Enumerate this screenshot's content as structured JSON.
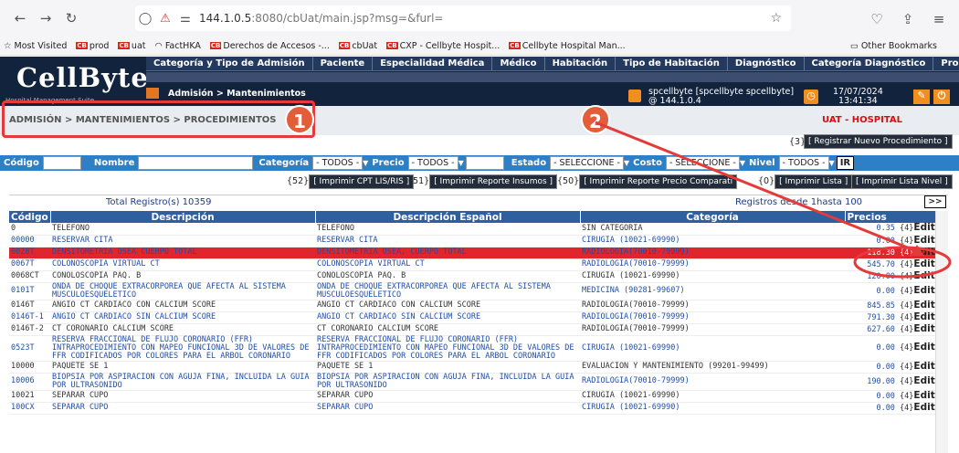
{
  "browser": {
    "url": "144.1.0.5:8080/cbUat/main.jsp?msg=&furl=",
    "url_host": "144.1.0.5",
    "url_rest": ":8080/cbUat/main.jsp?msg=&furl=",
    "bookmarks": [
      "Most Visited",
      "prod",
      "uat",
      "FactHKA",
      "Derechos de Accesos -...",
      "cbUat",
      "CXP - Cellbyte Hospit...",
      "Cellbyte Hospital Man..."
    ],
    "other_bookmarks": "Other Bookmarks",
    "cb_label": "CB"
  },
  "app": {
    "logo": "CellByte",
    "logo_sub": "Hospital Management Suite",
    "menu": [
      "Categoría y Tipo de Admisión",
      "Paciente",
      "Especialidad Médica",
      "Médico",
      "Habitación",
      "Tipo de Habitación",
      "Diagnóstico",
      "Categoría Diagnóstico",
      "Procedi"
    ],
    "nav_crumb": "Admisión > Mantenimientos",
    "user_line1": "spcellbyte [spcellbyte spcellbyte]",
    "user_line2": "@ 144.1.0.4",
    "date": "17/07/2024",
    "time": "13:41:34"
  },
  "page": {
    "breadcrumb": "ADMISIÓN > MANTENIMIENTOS > PROCEDIMIENTOS",
    "hospital": "UAT - HOSPITAL",
    "reg_count": "{3}",
    "reg_button": "[ Registrar Nuevo Procedimiento ]"
  },
  "filters": {
    "codigo": "Código",
    "nombre": "Nombre",
    "categoria": "Categoría",
    "categoria_val": "- TODOS -",
    "precio": "Precio",
    "precio_val": "- TODOS -",
    "estado": "Estado",
    "estado_val": "- SELECCIONE -",
    "costo": "Costo",
    "costo_val": "- SELECCIONE -",
    "nivel": "Nivel",
    "nivel_val": "- TODOS -",
    "ir": "IR"
  },
  "actions": {
    "c1": "{52}",
    "b1": "[ Imprimir CPT LIS/RIS ]",
    "c2": "{51}",
    "b2": "[ Imprimir Reporte Insumos ]",
    "c3": "{50}",
    "b3": "[ Imprimir Reporte Precio Comparati",
    "c4": "{0}",
    "b4": "[ Imprimir Lista ]",
    "b5": "[ Imprimir Lista Nivel ]"
  },
  "pager": {
    "total": "Total Registro(s) 10359",
    "range": "Registros desde 1hasta 100",
    "next": ">>"
  },
  "table": {
    "headers": [
      "Código",
      "Descripción",
      "Descripción Español",
      "Categoría",
      "Precios"
    ],
    "edit_label": "Editar",
    "edit_count": "{4}",
    "rows": [
      {
        "code": "0",
        "desc": "TELEFONO",
        "desc_es": "TELEFONO",
        "cat": "SIN CATEGORIA",
        "price": "0.35",
        "blue": false
      },
      {
        "code": "00000",
        "desc": "RESERVAR CITA",
        "desc_es": "RESERVAR CITA",
        "cat": "CIRUGIA (10021-69990)",
        "price": "0.00",
        "blue": true
      },
      {
        "code": "0028T",
        "desc": "DENSITOMETRIA OSEA CUERPO TOTAL",
        "desc_es": "DENSITOMETRIA OSEA, CUERPO TOTAL",
        "cat": "RADIOLOGIA(70010-79999)",
        "price": "118.30",
        "blue": true,
        "highlight": true
      },
      {
        "code": "0067T",
        "desc": "COLONOSCOPIA VIRTUAL CT",
        "desc_es": "COLONOSCOPIA VIRTUAL CT",
        "cat": "RADIOLOGIA(70010-79999)",
        "price": "545.70",
        "blue": true
      },
      {
        "code": "0068CT",
        "desc": "CONOLOSCOPIA PAQ. B",
        "desc_es": "CONOLOSCOPIA PAQ. B",
        "cat": "CIRUGIA (10021-69990)",
        "price": "120.00",
        "blue": false
      },
      {
        "code": "0101T",
        "desc": "ONDA DE CHOQUE EXTRACORPOREA QUE AFECTA AL SISTEMA MUSCULOESQUELETICO",
        "desc_es": "ONDA DE CHOQUE EXTRACORPOREA QUE AFECTA AL SISTEMA MUSCULOESQUELETICO",
        "cat": "MEDICINA (90281-99607)",
        "price": "0.00",
        "blue": true
      },
      {
        "code": "0146T",
        "desc": "ANGIO CT CARDIACO CON CALCIUM SCORE",
        "desc_es": "ANGIO CT CARDIACO CON CALCIUM SCORE",
        "cat": "RADIOLOGIA(70010-79999)",
        "price": "845.85",
        "blue": false
      },
      {
        "code": "0146T-1",
        "desc": "ANGIO CT CARDIACO SIN CALCIUM SCORE",
        "desc_es": "ANGIO CT CARDIACO SIN CALCIUM SCORE",
        "cat": "RADIOLOGIA(70010-79999)",
        "price": "791.30",
        "blue": true
      },
      {
        "code": "0146T-2",
        "desc": "CT CORONARIO CALCIUM SCORE",
        "desc_es": "CT CORONARIO CALCIUM SCORE",
        "cat": "RADIOLOGIA(70010-79999)",
        "price": "627.60",
        "blue": false
      },
      {
        "code": "0523T",
        "desc": "RESERVA FRACCIONAL DE FLUJO CORONARIO (FFR) INTRAPROCEDIMIENTO CON MAPEO FUNCIONAL 3D DE VALORES DE FFR CODIFICADOS POR COLORES PARA EL ARBOL CORONARIO",
        "desc_es": "RESERVA FRACCIONAL DE FLUJO CORONARIO (FFR) INTRAPROCEDIMIENTO CON MAPEO FUNCIONAL 3D DE VALORES DE FFR CODIFICADOS POR COLORES PARA EL ARBOL CORONARIO",
        "cat": "CIRUGIA (10021-69990)",
        "price": "0.00",
        "blue": true
      },
      {
        "code": "10000",
        "desc": "PAQUETE SE 1",
        "desc_es": "PAQUETE SE 1",
        "cat": "EVALUACION Y MANTENIMIENTO (99201-99499)",
        "price": "0.00",
        "blue": false
      },
      {
        "code": "10006",
        "desc": "BIOPSIA POR ASPIRACION CON AGUJA FINA, INCLUIDA LA GUIA POR ULTRASONIDO",
        "desc_es": "BIOPSIA POR ASPIRACION CON AGUJA FINA, INCLUIDA LA GUIA POR ULTRASONIDO",
        "cat": "RADIOLOGIA(70010-79999)",
        "price": "190.00",
        "blue": true
      },
      {
        "code": "10021",
        "desc": "SEPARAR CUPO",
        "desc_es": "SEPARAR CUPO",
        "cat": "CIRUGIA (10021-69990)",
        "price": "0.00",
        "blue": false
      },
      {
        "code": "100CX",
        "desc": "SEPARAR CUPO",
        "desc_es": "SEPARAR CUPO",
        "cat": "CIRUGIA (10021-69990)",
        "price": "0.00",
        "blue": true
      }
    ]
  },
  "callouts": [
    "1",
    "2"
  ],
  "colors": {
    "header": "#12233e",
    "accent": "#f08f1f",
    "filter_bar": "#2f7fc7",
    "highlight": "#e0262c",
    "callout": "#e35d3b"
  }
}
